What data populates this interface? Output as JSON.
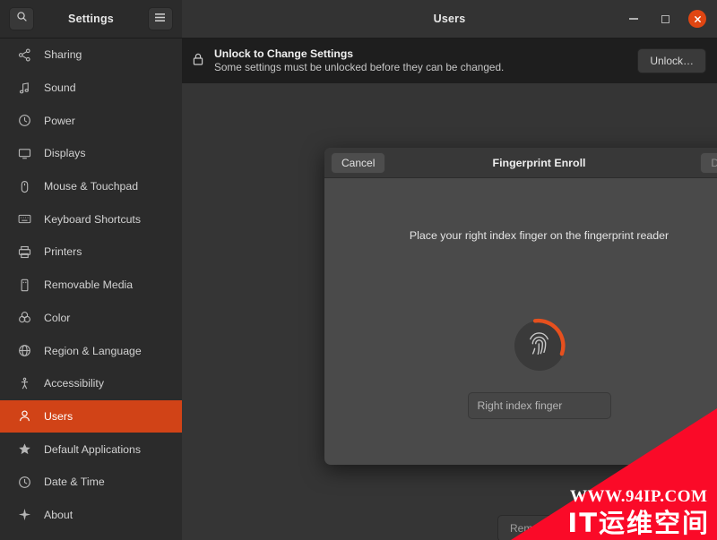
{
  "window": {
    "settings_title": "Settings",
    "page_title": "Users",
    "search_icon": "search-icon",
    "menu_icon": "hamburger-menu-icon",
    "minimize_label": "Minimize",
    "maximize_label": "Maximize",
    "close_label": "Close"
  },
  "sidebar": {
    "items": [
      {
        "label": "Sharing",
        "icon": "share-nodes-icon",
        "selected": false
      },
      {
        "label": "Sound",
        "icon": "music-note-icon",
        "selected": false
      },
      {
        "label": "Power",
        "icon": "power-icon",
        "selected": false
      },
      {
        "label": "Displays",
        "icon": "monitor-icon",
        "selected": false
      },
      {
        "label": "Mouse & Touchpad",
        "icon": "mouse-icon",
        "selected": false
      },
      {
        "label": "Keyboard Shortcuts",
        "icon": "keyboard-icon",
        "selected": false
      },
      {
        "label": "Printers",
        "icon": "printer-icon",
        "selected": false
      },
      {
        "label": "Removable Media",
        "icon": "removable-media-icon",
        "selected": false
      },
      {
        "label": "Color",
        "icon": "color-circles-icon",
        "selected": false
      },
      {
        "label": "Region & Language",
        "icon": "globe-icon",
        "selected": false
      },
      {
        "label": "Accessibility",
        "icon": "accessibility-icon",
        "selected": false
      },
      {
        "label": "Users",
        "icon": "user-icon",
        "selected": true
      },
      {
        "label": "Default Applications",
        "icon": "star-icon",
        "selected": false
      },
      {
        "label": "Date & Time",
        "icon": "clock-icon",
        "selected": false
      },
      {
        "label": "About",
        "icon": "sparkle-icon",
        "selected": false
      }
    ]
  },
  "infobar": {
    "icon": "lock-icon",
    "title": "Unlock to Change Settings",
    "subtitle": "Some settings must be unlocked before they can be changed.",
    "unlock_label": "Unlock…"
  },
  "background_page": {
    "avatar_edit_icon": "pencil-edit-icon",
    "rows": [
      {
        "type": "chevron",
        "icon": "chevron-right-icon"
      },
      {
        "type": "chevron",
        "icon": "chevron-right-icon"
      },
      {
        "type": "toggle",
        "icon": "toggle-switch"
      },
      {
        "type": "chevron",
        "icon": "chevron-right-icon"
      }
    ],
    "remove_user_label": "Remove User…"
  },
  "modal": {
    "cancel_label": "Cancel",
    "title": "Fingerprint Enroll",
    "done_label": "Done",
    "instruction": "Place your right index finger on the fingerprint reader",
    "fingerprint_icon": "fingerprint-icon",
    "progress_percent": 33,
    "progress_color": "#e6501e",
    "finger_name_value": "Right index finger",
    "finger_name_placeholder": "Right index finger"
  },
  "watermark": {
    "url": "WWW.94IP.COM",
    "text": "IT运维空间",
    "color": "#fa0a28"
  },
  "theme": {
    "accent": "#d14317",
    "close_button": "#e04612",
    "sidebar_bg": "#2b2b2b",
    "content_bg": "#353535",
    "modal_bg": "#4a4a4a",
    "infobar_bg": "#1e1e1e"
  }
}
